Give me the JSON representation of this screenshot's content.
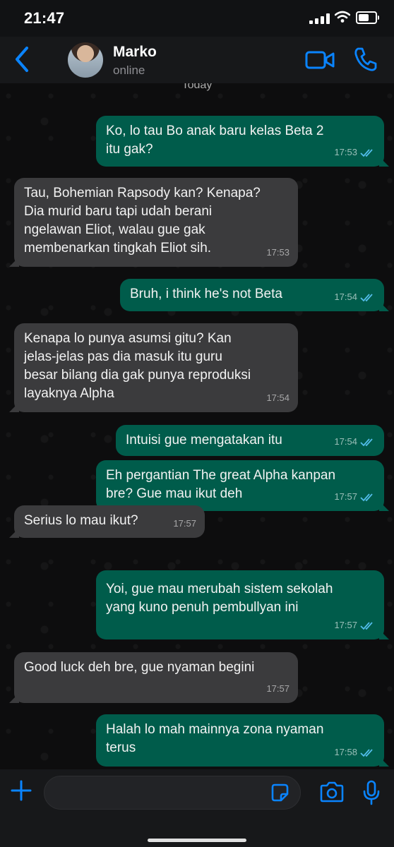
{
  "status_bar": {
    "time": "21:47"
  },
  "header": {
    "contact_name": "Marko",
    "contact_status": "online"
  },
  "chat": {
    "date_label": "Today",
    "messages": [
      {
        "dir": "out",
        "text": "Ko, lo tau Bo anak baru kelas Beta 2\nitu gak?",
        "time": "17:53"
      },
      {
        "dir": "in",
        "text": "Tau, Bohemian Rapsody kan? Kenapa?\nDia murid baru tapi udah berani\nngelawan Eliot, walau gue gak\nmembenarkan tingkah Eliot sih.",
        "time": "17:53"
      },
      {
        "dir": "out",
        "text": "Bruh, i think he's not Beta",
        "time": "17:54"
      },
      {
        "dir": "in",
        "text": "Kenapa lo punya asumsi gitu? Kan\njelas-jelas pas dia masuk itu guru\nbesar bilang dia gak punya reproduksi\nlayaknya Alpha",
        "time": "17:54"
      },
      {
        "dir": "out",
        "text": "Intuisi gue mengatakan itu",
        "time": "17:54"
      },
      {
        "dir": "out",
        "text": "Eh pergantian The great Alpha kanpan\nbre? Gue mau ikut deh",
        "time": "17:57"
      },
      {
        "dir": "in",
        "text": "Serius lo mau ikut?",
        "time": "17:57"
      },
      {
        "dir": "out",
        "text": "Yoi, gue mau merubah sistem sekolah\nyang kuno penuh pembullyan ini",
        "time": "17:57"
      },
      {
        "dir": "in",
        "text": "Good luck deh bre, gue nyaman begini",
        "time": "17:57"
      },
      {
        "dir": "out",
        "text": "Halah lo mah mainnya zona nyaman\nterus",
        "time": "17:58"
      }
    ]
  },
  "input_bar": {
    "message_value": "",
    "message_placeholder": ""
  },
  "colors": {
    "accent": "#0a84ff",
    "outgoing_bubble": "#005c4b",
    "incoming_bubble": "#3b3b3d",
    "read_ticks": "#53bdeb"
  }
}
